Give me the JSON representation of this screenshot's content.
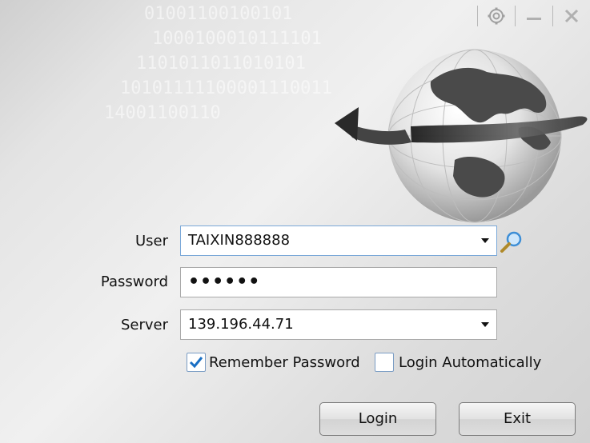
{
  "background_text": {
    "line1": "01001100100101",
    "line2": "1000100010111101",
    "line3": "1101011011010101",
    "line4": "10101111100001110011",
    "line5": "14001100110"
  },
  "window_controls": {
    "settings": "settings-icon",
    "minimize": "minimize-icon",
    "close": "close-icon"
  },
  "form": {
    "user_label": "User",
    "user_value": "TAIXIN888888",
    "password_label": "Password",
    "password_value": "••••••",
    "server_label": "Server",
    "server_value": "139.196.44.71",
    "remember_label": "Remember Password",
    "remember_checked": true,
    "auto_label": "Login Automatically",
    "auto_checked": false
  },
  "buttons": {
    "login": "Login",
    "exit": "Exit"
  },
  "colors": {
    "check_accent": "#1a6fc4",
    "focus_border": "#7aa8d8"
  }
}
